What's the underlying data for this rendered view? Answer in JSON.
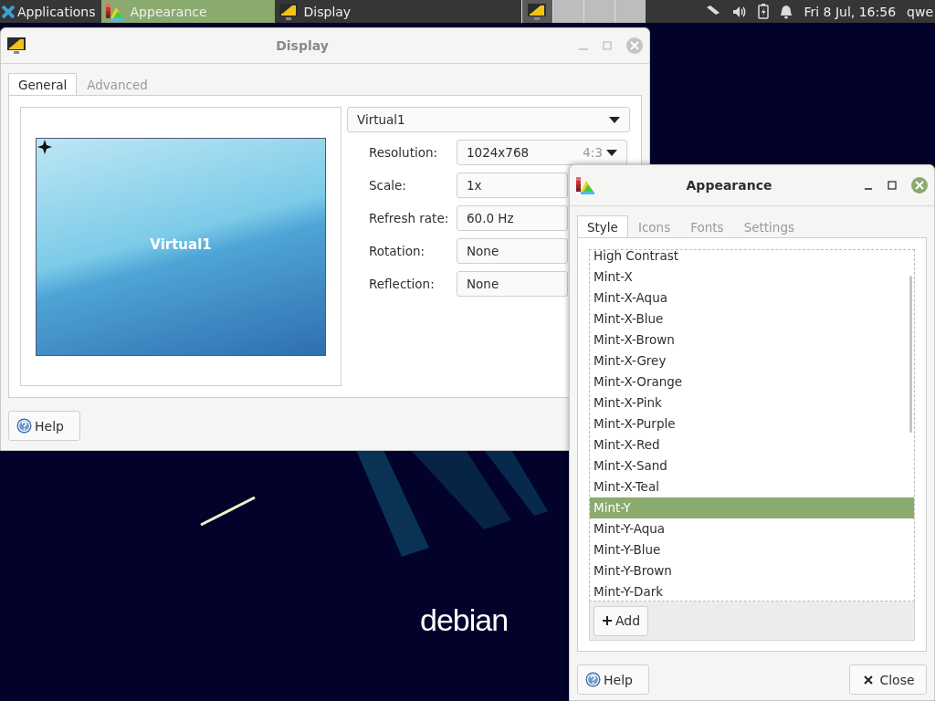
{
  "taskbar": {
    "menu_label": "Applications",
    "tasks": [
      {
        "label": "Appearance",
        "selected": true,
        "kind": "appearance"
      },
      {
        "label": "Display",
        "selected": false,
        "kind": "display"
      }
    ],
    "workspaces": [
      {
        "selected": true
      },
      {
        "selected": false
      },
      {
        "selected": false
      },
      {
        "selected": false
      }
    ],
    "clock": "Fri  8 Jul, 16:56",
    "user": "qwe"
  },
  "desktop": {
    "logo_text": "debian"
  },
  "display_window": {
    "title": "Display",
    "tabs": [
      {
        "label": "General",
        "selected": true
      },
      {
        "label": "Advanced",
        "selected": false
      }
    ],
    "preview": {
      "label": "Virtual1"
    },
    "output": "Virtual1",
    "settings": [
      {
        "label": "Resolution:",
        "value": "1024x768",
        "aspect": "4:3"
      },
      {
        "label": "Scale:",
        "value": "1x"
      },
      {
        "label": "Refresh rate:",
        "value": "60.0 Hz"
      },
      {
        "label": "Rotation:",
        "value": "None"
      },
      {
        "label": "Reflection:",
        "value": "None"
      }
    ],
    "help_button": "Help"
  },
  "appearance_window": {
    "title": "Appearance",
    "tabs": [
      {
        "label": "Style",
        "selected": true
      },
      {
        "label": "Icons",
        "selected": false
      },
      {
        "label": "Fonts",
        "selected": false
      },
      {
        "label": "Settings",
        "selected": false
      }
    ],
    "themes": [
      {
        "name": "High Contrast",
        "selected": false
      },
      {
        "name": "Mint-X",
        "selected": false
      },
      {
        "name": "Mint-X-Aqua",
        "selected": false
      },
      {
        "name": "Mint-X-Blue",
        "selected": false
      },
      {
        "name": "Mint-X-Brown",
        "selected": false
      },
      {
        "name": "Mint-X-Grey",
        "selected": false
      },
      {
        "name": "Mint-X-Orange",
        "selected": false
      },
      {
        "name": "Mint-X-Pink",
        "selected": false
      },
      {
        "name": "Mint-X-Purple",
        "selected": false
      },
      {
        "name": "Mint-X-Red",
        "selected": false
      },
      {
        "name": "Mint-X-Sand",
        "selected": false
      },
      {
        "name": "Mint-X-Teal",
        "selected": false
      },
      {
        "name": "Mint-Y",
        "selected": true
      },
      {
        "name": "Mint-Y-Aqua",
        "selected": false
      },
      {
        "name": "Mint-Y-Blue",
        "selected": false
      },
      {
        "name": "Mint-Y-Brown",
        "selected": false
      },
      {
        "name": "Mint-Y-Dark",
        "selected": false
      }
    ],
    "add_button": "Add",
    "help_button": "Help",
    "close_button": "Close"
  }
}
